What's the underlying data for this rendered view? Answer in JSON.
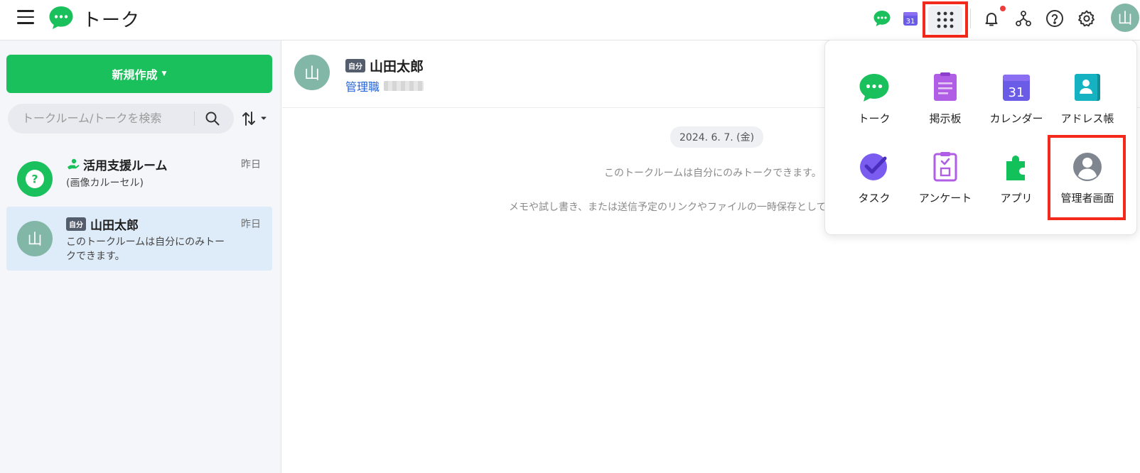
{
  "header": {
    "app_title": "トーク",
    "icons": [
      "menu-icon",
      "talk-logo-icon",
      "talk-icon",
      "calendar-icon",
      "apps-grid-icon",
      "bell-icon",
      "org-chart-icon",
      "help-icon",
      "gear-icon"
    ],
    "calendar_day": "31",
    "user_avatar_initial": "山",
    "notification_dot_color": "#ee3d3d",
    "highlight_color": "#f2291b"
  },
  "sidebar": {
    "new_button_label": "新規作成",
    "search_placeholder": "トークルーム/トークを検索",
    "rooms": [
      {
        "name": "活用支援ルーム",
        "time": "昨日",
        "preview": "(画像カルーセル)",
        "avatar_glyph": "?",
        "avatar_color": "#1ac05b"
      },
      {
        "badge": "自分",
        "name": "山田太郎",
        "time": "昨日",
        "preview": "このトークルームは自分にのみトークできます。",
        "avatar_glyph": "山",
        "avatar_color": "#82b7a8",
        "selected": true
      }
    ]
  },
  "main": {
    "badge": "自分",
    "name": "山田太郎",
    "role": "管理職",
    "avatar_initial": "山",
    "date": "2024. 6. 7. (金)",
    "system_messages": [
      "このトークルームは自分にのみトークできます。",
      "メモや試し書き、または送信予定のリンクやファイルの一時保存として"
    ]
  },
  "app_menu": {
    "items": [
      {
        "label": "トーク",
        "icon": "talk-icon"
      },
      {
        "label": "掲示板",
        "icon": "board-icon"
      },
      {
        "label": "カレンダー",
        "icon": "calendar-icon"
      },
      {
        "label": "アドレス帳",
        "icon": "address-book-icon"
      },
      {
        "label": "タスク",
        "icon": "task-icon"
      },
      {
        "label": "アンケート",
        "icon": "survey-icon"
      },
      {
        "label": "アプリ",
        "icon": "app-puzzle-icon"
      },
      {
        "label": "管理者画面",
        "icon": "admin-user-icon"
      }
    ],
    "calendar_day": "31"
  },
  "colors": {
    "brand_green": "#1ac05b",
    "selected_row": "#deebf8",
    "link_blue": "#2563d8",
    "purple": "#7b5cf0"
  }
}
